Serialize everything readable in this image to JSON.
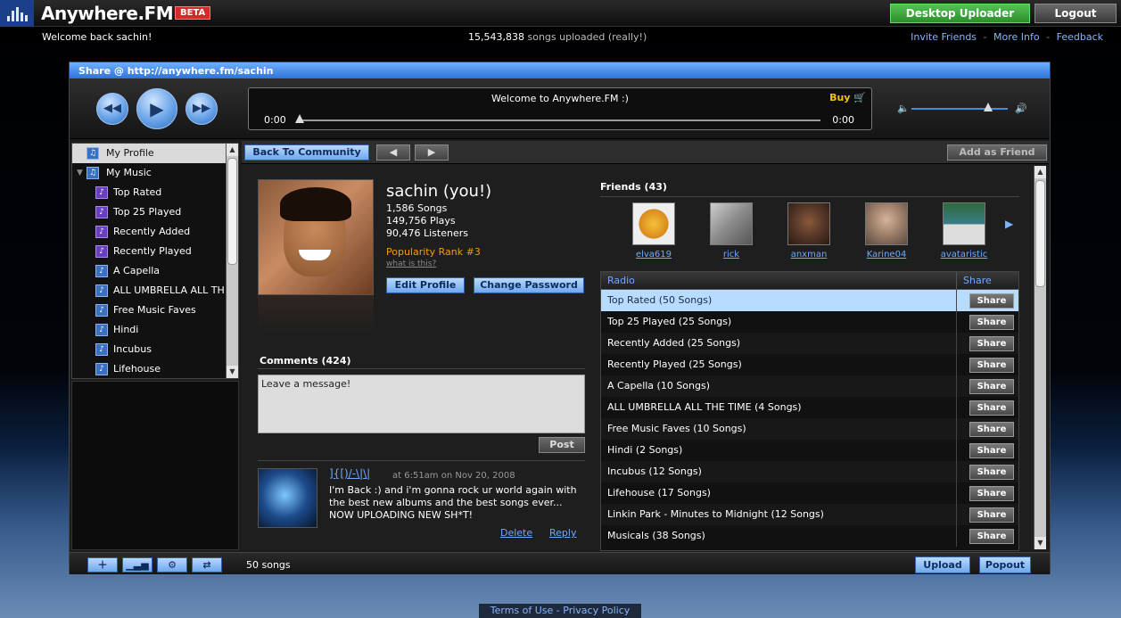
{
  "topbar": {
    "logo_text": "Anywhere.FM",
    "beta_label": "BETA",
    "desktop_uploader_label": "Desktop Uploader",
    "logout_label": "Logout"
  },
  "subbar": {
    "welcome_text": "Welcome back sachin!",
    "songs_count": "15,543,838",
    "songs_suffix": "songs uploaded (really!)",
    "links": [
      "Invite Friends",
      "More Info",
      "Feedback"
    ],
    "link_separator": "-"
  },
  "window": {
    "title": "Share @ http://anywhere.fm/sachin"
  },
  "player": {
    "title": "Welcome to Anywhere.FM :)",
    "buy_label": "Buy",
    "time_start": "0:00",
    "time_end": "0:00",
    "volume_fraction": 0.8
  },
  "sidebar": {
    "items": [
      {
        "label": "My Profile",
        "level": 0,
        "selected": true
      },
      {
        "label": "My Music",
        "level": 0,
        "expanded": true
      },
      {
        "label": "Top Rated",
        "level": 1
      },
      {
        "label": "Top 25 Played",
        "level": 1
      },
      {
        "label": "Recently Added",
        "level": 1
      },
      {
        "label": "Recently Played",
        "level": 1
      },
      {
        "label": "A Capella",
        "level": 1
      },
      {
        "label": "ALL UMBRELLA ALL TH",
        "level": 1
      },
      {
        "label": "Free Music Faves",
        "level": 1
      },
      {
        "label": "Hindi",
        "level": 1
      },
      {
        "label": "Incubus",
        "level": 1
      },
      {
        "label": "Lifehouse",
        "level": 1
      }
    ]
  },
  "nav": {
    "back_label": "Back To Community",
    "prev_label": "◀",
    "next_label": "▶",
    "add_friend_label": "Add as Friend"
  },
  "profile": {
    "name": "sachin (you!)",
    "songs": "1,586 Songs",
    "plays": "149,756 Plays",
    "listeners": "90,476 Listeners",
    "rank": "Popularity Rank #3",
    "what_is_this": "what is this?",
    "edit_profile_label": "Edit Profile",
    "change_password_label": "Change Password"
  },
  "comments": {
    "heading": "Comments (424)",
    "placeholder": "Leave a message!",
    "post_label": "Post",
    "items": [
      {
        "author": "]{[)/-\\|\\|",
        "date": "at 6:51am on Nov 20, 2008",
        "text": "I'm Back :) and i'm gonna rock ur world again with the best new albums and the best songs ever... NOW UPLOADING NEW SH*T!",
        "delete_label": "Delete",
        "reply_label": "Reply"
      }
    ]
  },
  "friends": {
    "heading": "Friends (43)",
    "items": [
      {
        "name": "elva619",
        "color": "#d98a1c"
      },
      {
        "name": "rick",
        "color": "#8a8a8a"
      },
      {
        "name": "anxman",
        "color": "#5a3a2a"
      },
      {
        "name": "Karine04",
        "color": "#a0826d"
      },
      {
        "name": "avataristic",
        "color": "#2d6a3a"
      }
    ]
  },
  "radio": {
    "col_radio": "Radio",
    "col_share": "Share",
    "share_label": "Share",
    "rows": [
      {
        "name": "Top Rated (50 Songs)",
        "selected": true
      },
      {
        "name": "Top 25 Played (25 Songs)"
      },
      {
        "name": "Recently Added (25 Songs)"
      },
      {
        "name": "Recently Played (25 Songs)"
      },
      {
        "name": "A Capella (10 Songs)"
      },
      {
        "name": "ALL UMBRELLA ALL THE TIME (4 Songs)"
      },
      {
        "name": "Free Music Faves (10 Songs)"
      },
      {
        "name": "Hindi (2 Songs)"
      },
      {
        "name": "Incubus (12 Songs)"
      },
      {
        "name": "Lifehouse (17 Songs)"
      },
      {
        "name": "Linkin Park - Minutes to Midnight (12 Songs)"
      },
      {
        "name": "Musicals (38 Songs)"
      }
    ]
  },
  "bottombar": {
    "count_text": "50 songs",
    "upload_label": "Upload",
    "popout_label": "Popout"
  },
  "footer": {
    "terms_label": "Terms of Use",
    "privacy_label": "Privacy Policy",
    "separator": "-"
  }
}
